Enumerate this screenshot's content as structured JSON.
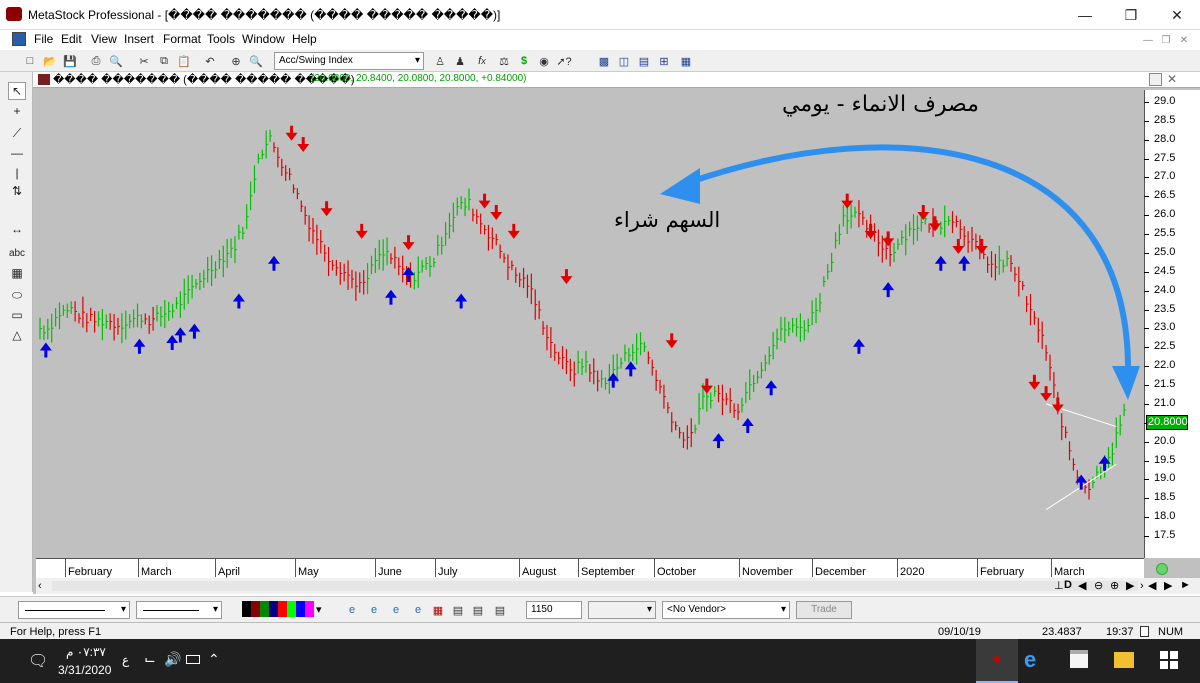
{
  "app": {
    "title": "MetaStock Professional - [���� ������� (���� ����� �����)]",
    "menu": [
      "File",
      "Edit",
      "View",
      "Insert",
      "Format",
      "Tools",
      "Window",
      "Help"
    ]
  },
  "toolbar": {
    "indicator_combo": "Acc/Swing Index"
  },
  "chart_window": {
    "title": "���� ������� (���� ����� �����)",
    "ohlc": "(20.0800, 20.8400, 20.0800, 20.8000, +0.84000)",
    "last_price": "20.8000"
  },
  "annotations": {
    "heading": "مصرف الانماء - يومي",
    "buy_label": "السهم شراء"
  },
  "bottom_tools": {
    "periods": "1150",
    "vendor": "<No Vendor>",
    "trade_button": "Trade"
  },
  "status": {
    "help": "For Help, press F1",
    "date": "09/10/19",
    "value": "23.4837",
    "time": "19:37",
    "mode": "NUM"
  },
  "taskbar": {
    "time": "٠٧:٣٧ م",
    "date": "3/31/2020",
    "lang": "ع"
  },
  "chart_data": {
    "type": "bar",
    "y_ticks": [
      "29.0",
      "28.5",
      "28.0",
      "27.5",
      "27.0",
      "26.5",
      "26.0",
      "25.5",
      "25.0",
      "24.5",
      "24.0",
      "23.5",
      "23.0",
      "22.5",
      "22.0",
      "21.5",
      "21.0",
      "20.5",
      "20.0",
      "19.5",
      "19.0",
      "18.5",
      "18.0",
      "17.5"
    ],
    "ylim": [
      17.5,
      29.0
    ],
    "x_ticks": [
      "February",
      "March",
      "April",
      "May",
      "June",
      "July",
      "August",
      "September",
      "October",
      "November",
      "December",
      "2020",
      "February",
      "March"
    ],
    "up_color": "#00c000",
    "down_color": "#e00000",
    "buy_arrow_color": "#0000e0",
    "sell_arrow_color": "#e00000",
    "annotation_arrow_color": "#2f8fee",
    "closes": [
      23.0,
      23.4,
      23.5,
      23.3,
      23.2,
      23.2,
      23.1,
      23.2,
      23.3,
      23.2,
      23.4,
      23.6,
      23.9,
      24.3,
      24.6,
      24.9,
      25.2,
      25.9,
      27.6,
      28.0,
      27.4,
      26.8,
      26.0,
      25.4,
      24.9,
      24.6,
      24.3,
      24.1,
      24.8,
      25.0,
      24.6,
      24.3,
      24.6,
      24.8,
      25.6,
      26.2,
      26.3,
      25.8,
      25.4,
      24.9,
      24.4,
      24.2,
      23.4,
      22.6,
      22.1,
      21.9,
      22.1,
      21.6,
      21.7,
      22.1,
      22.5,
      22.5,
      21.7,
      20.9,
      20.2,
      20.1,
      21.1,
      21.3,
      21.1,
      20.9,
      21.5,
      22.0,
      22.6,
      23.0,
      23.0,
      23.1,
      23.8,
      24.9,
      26.0,
      26.0,
      25.7,
      25.3,
      25.0,
      25.4,
      25.7,
      25.8,
      25.7,
      26.0,
      25.7,
      25.3,
      24.9,
      24.6,
      24.8,
      24.3,
      23.4,
      22.8,
      21.4,
      20.1,
      19.1,
      18.8,
      19.3,
      19.8,
      20.8
    ],
    "buy_signals": [
      [
        0.5,
        22.6
      ],
      [
        8.5,
        22.7
      ],
      [
        11.3,
        22.8
      ],
      [
        12.0,
        23.0
      ],
      [
        13.2,
        23.1
      ],
      [
        17.0,
        23.9
      ],
      [
        20.0,
        24.9
      ],
      [
        30.0,
        24.0
      ],
      [
        31.5,
        24.6
      ],
      [
        36.0,
        23.9
      ],
      [
        49.0,
        21.8
      ],
      [
        50.5,
        22.1
      ],
      [
        58.0,
        20.2
      ],
      [
        60.5,
        20.6
      ],
      [
        62.5,
        21.6
      ],
      [
        70.0,
        22.7
      ],
      [
        72.5,
        24.2
      ],
      [
        77.0,
        24.9
      ],
      [
        79.0,
        24.9
      ],
      [
        89.0,
        19.1
      ],
      [
        91.0,
        19.6
      ]
    ],
    "sell_signals": [
      [
        21.5,
        28.0
      ],
      [
        22.5,
        27.7
      ],
      [
        24.5,
        26.0
      ],
      [
        27.5,
        25.4
      ],
      [
        31.5,
        25.1
      ],
      [
        38.0,
        26.2
      ],
      [
        39.0,
        25.9
      ],
      [
        40.5,
        25.4
      ],
      [
        45.0,
        24.2
      ],
      [
        54.0,
        22.5
      ],
      [
        57.0,
        21.3
      ],
      [
        69.0,
        26.2
      ],
      [
        71.0,
        25.4
      ],
      [
        72.5,
        25.2
      ],
      [
        75.5,
        25.9
      ],
      [
        76.5,
        25.6
      ],
      [
        78.5,
        25.0
      ],
      [
        80.5,
        25.0
      ],
      [
        85.0,
        21.4
      ],
      [
        86.0,
        21.1
      ],
      [
        87.0,
        20.8
      ]
    ]
  }
}
